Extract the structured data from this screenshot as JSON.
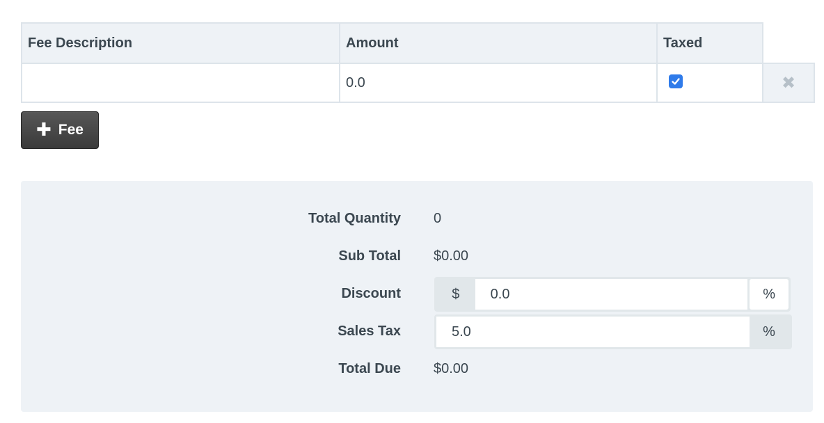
{
  "fees": {
    "headers": {
      "description": "Fee Description",
      "amount": "Amount",
      "taxed": "Taxed"
    },
    "rows": [
      {
        "description": "",
        "amount": "0.0",
        "taxed": true,
        "delete_icon": "close-icon"
      }
    ],
    "add_button_label": "Fee",
    "add_button_icon": "plus-icon"
  },
  "totals": {
    "total_quantity_label": "Total Quantity",
    "total_quantity_value": "0",
    "subtotal_label": "Sub Total",
    "subtotal_value": "$0.00",
    "discount_label": "Discount",
    "discount_prefix": "$",
    "discount_value": "0.0",
    "discount_suffix": "%",
    "sales_tax_label": "Sales Tax",
    "sales_tax_value": "5.0",
    "sales_tax_suffix": "%",
    "total_due_label": "Total Due",
    "total_due_value": "$0.00"
  },
  "colors": {
    "panel_background": "#eef2f6",
    "checkbox_accent": "#2f7bea",
    "button_background": "#474747"
  }
}
